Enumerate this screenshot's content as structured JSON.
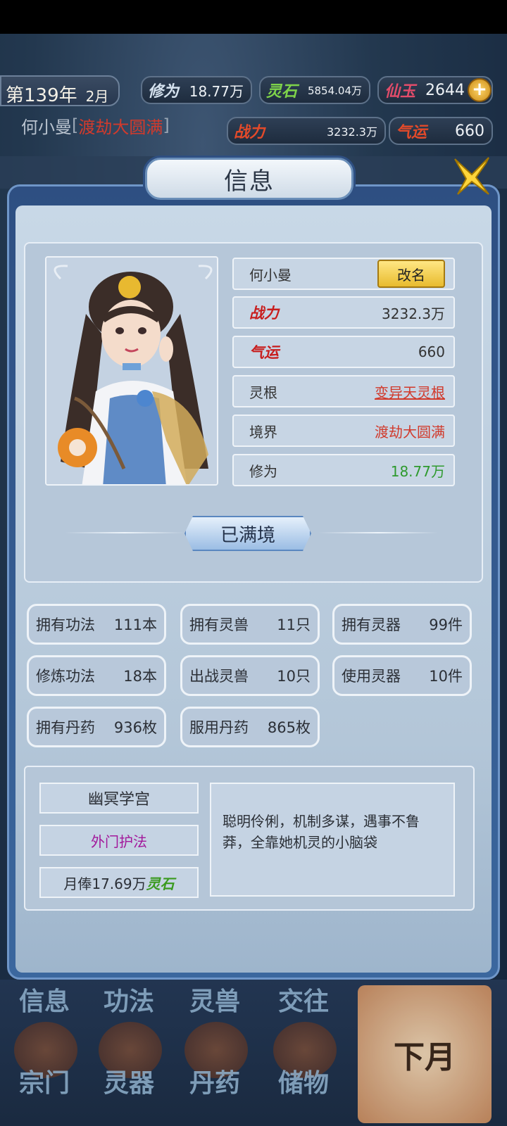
{
  "hud": {
    "year": "第139年",
    "month": "2月",
    "cultivation_label": "修为",
    "cultivation_value": "18.77万",
    "spirit_stone_label": "灵石",
    "spirit_stone_value": "5854.04万",
    "jade_label": "仙玉",
    "jade_value": "2644",
    "plus_icon": "+",
    "character_name": "何小曼",
    "character_realm": "渡劫大圆满",
    "power_label": "战力",
    "power_value": "3232.3万",
    "luck_label": "气运",
    "luck_value": "660"
  },
  "panel": {
    "title": "信息",
    "close_icon": "close-icon"
  },
  "profile": {
    "name": "何小曼",
    "rename_button": "改名",
    "power_label": "战力",
    "power_value": "3232.3万",
    "luck_label": "气运",
    "luck_value": "660",
    "root_label": "灵根",
    "root_value": "变异天灵根",
    "realm_label": "境界",
    "realm_value": "渡劫大圆满",
    "cultivation_label": "修为",
    "cultivation_value": "18.77万",
    "max_realm_button": "已满境"
  },
  "stats": [
    {
      "label": "拥有功法",
      "count": "111本"
    },
    {
      "label": "拥有灵兽",
      "count": "11只"
    },
    {
      "label": "拥有灵器",
      "count": "99件"
    },
    {
      "label": "修炼功法",
      "count": "18本"
    },
    {
      "label": "出战灵兽",
      "count": "10只"
    },
    {
      "label": "使用灵器",
      "count": "10件"
    },
    {
      "label": "拥有丹药",
      "count": "936枚"
    },
    {
      "label": "服用丹药",
      "count": "865枚"
    }
  ],
  "sect": {
    "name": "幽冥学宫",
    "position": "外门护法",
    "salary_prefix": "月俸17.69万",
    "salary_unit": "灵石",
    "description": "聪明伶俐，机制多谋，遇事不鲁莽，全靠她机灵的小脑袋"
  },
  "nav": {
    "row1": [
      "信息",
      "功法",
      "灵兽",
      "交往"
    ],
    "row2": [
      "宗门",
      "灵器",
      "丹药",
      "储物"
    ],
    "next_month": "下月"
  },
  "colors": {
    "realm_red": "#d13a2c",
    "cultivation_green": "#2e9a2e",
    "position_purple": "#a2189b",
    "rename_gold": "#f3cd45"
  }
}
